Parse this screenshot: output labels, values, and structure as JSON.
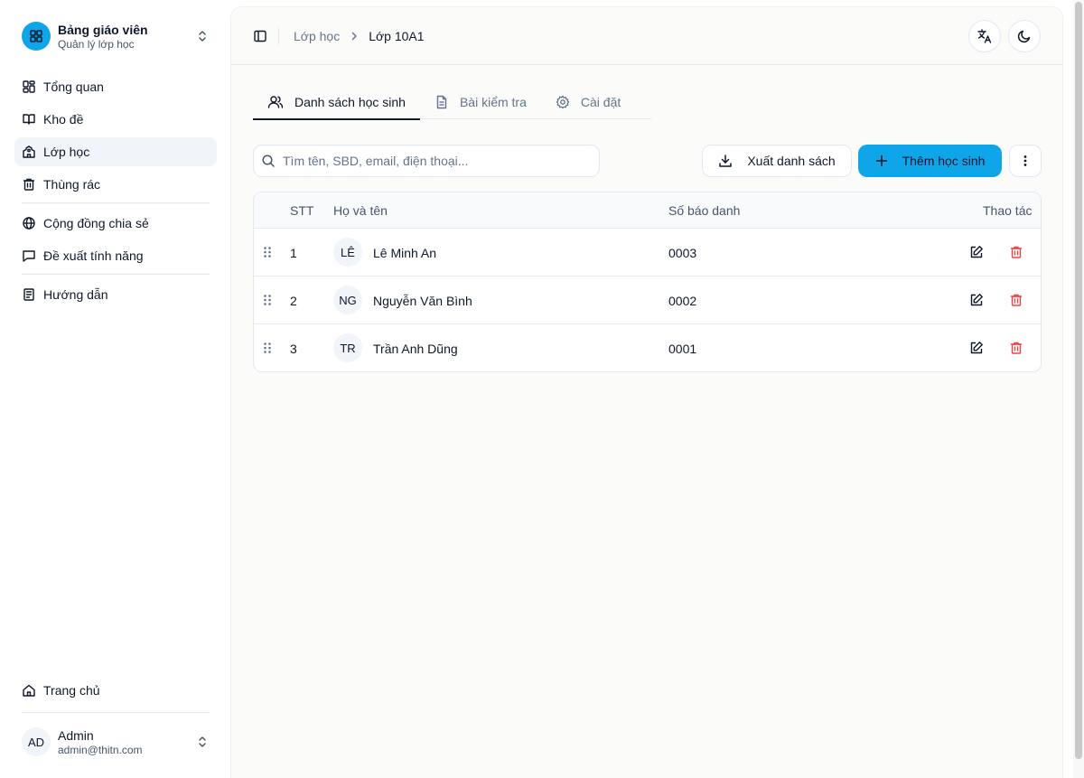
{
  "sidebar": {
    "brand_title": "Bảng giáo viên",
    "brand_subtitle": "Quản lý lớp học",
    "items": [
      {
        "label": "Tổng quan",
        "icon": "dashboard-icon"
      },
      {
        "label": "Kho đề",
        "icon": "book-icon"
      },
      {
        "label": "Lớp học",
        "icon": "school-icon",
        "active": true
      },
      {
        "label": "Thùng rác",
        "icon": "trash-icon"
      },
      {
        "label": "Cộng đồng chia sẻ",
        "icon": "globe-icon"
      },
      {
        "label": "Đề xuất tính năng",
        "icon": "message-icon"
      },
      {
        "label": "Hướng dẫn",
        "icon": "guide-icon"
      }
    ],
    "home_label": "Trang chủ",
    "user": {
      "initials": "AD",
      "name": "Admin",
      "email": "admin@thitn.com"
    }
  },
  "header": {
    "breadcrumb": [
      "Lớp học",
      "Lớp 10A1"
    ]
  },
  "tabs": [
    {
      "label": "Danh sách học sinh",
      "active": true
    },
    {
      "label": "Bài kiểm tra"
    },
    {
      "label": "Cài đặt"
    }
  ],
  "toolbar": {
    "search_placeholder": "Tìm tên, SBD, email, điện thoại...",
    "export_label": "Xuất danh sách",
    "add_label": "Thêm học sinh"
  },
  "table": {
    "columns": [
      "STT",
      "Họ và tên",
      "Số báo danh",
      "Thao tác"
    ],
    "rows": [
      {
        "stt": "1",
        "initials": "LÊ",
        "name": "Lê Minh An",
        "sbd": "0003"
      },
      {
        "stt": "2",
        "initials": "NG",
        "name": "Nguyễn Văn Bình",
        "sbd": "0002"
      },
      {
        "stt": "3",
        "initials": "TR",
        "name": "Trần Anh Dũng",
        "sbd": "0001"
      }
    ]
  },
  "colors": {
    "accent": "#0ea5e9",
    "danger": "#ef4444",
    "text": "#0f172a",
    "muted": "#64748b"
  }
}
